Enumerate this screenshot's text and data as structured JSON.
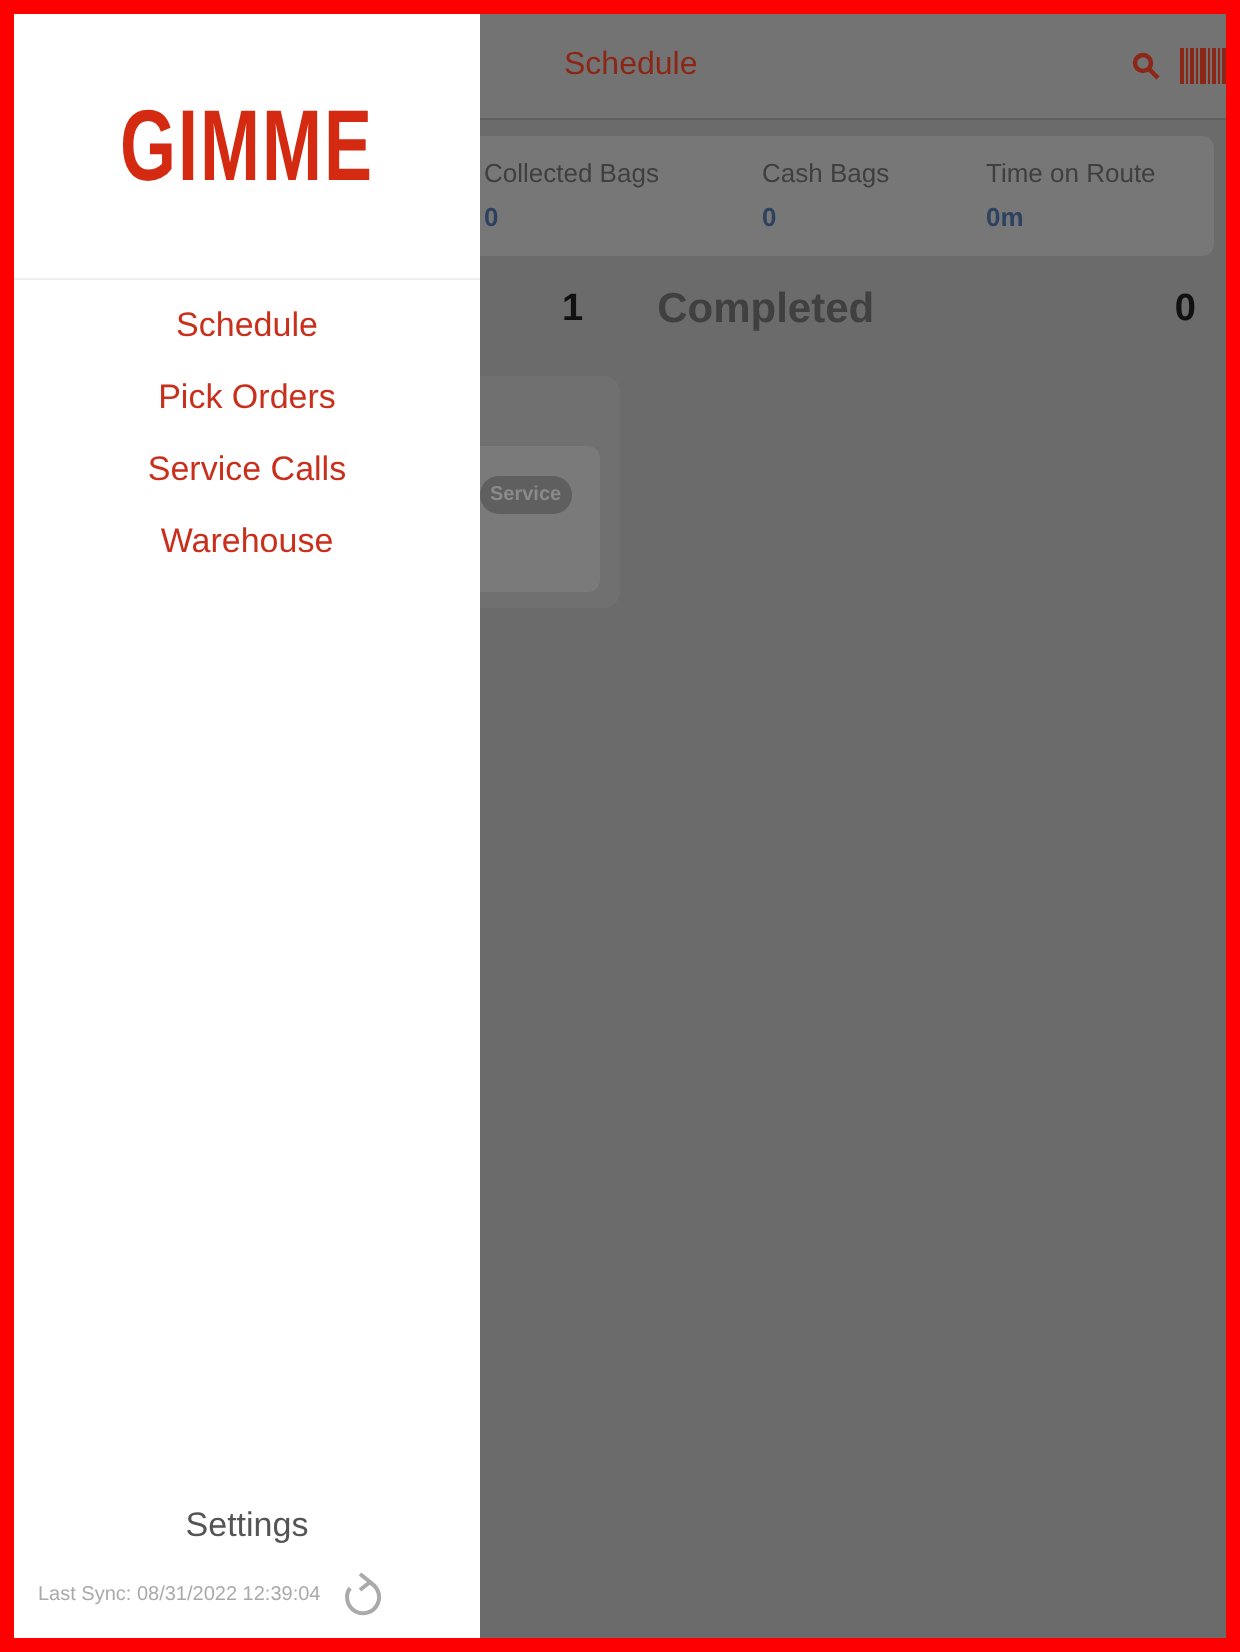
{
  "drawer": {
    "logo": "GIMME",
    "nav_items": [
      "Schedule",
      "Pick Orders",
      "Service Calls",
      "Warehouse"
    ],
    "settings": "Settings",
    "last_sync": "Last Sync: 08/31/2022 12:39:04"
  },
  "background": {
    "header_title": "Schedule",
    "stats": [
      {
        "label": "Collected Bags",
        "value": "0"
      },
      {
        "label": "Cash Bags",
        "value": "0"
      },
      {
        "label": "Time on Route",
        "value": "0m"
      }
    ],
    "scheduled_count": "1",
    "completed_label": "Completed",
    "completed_count": "0",
    "stop_tag": "Service"
  }
}
